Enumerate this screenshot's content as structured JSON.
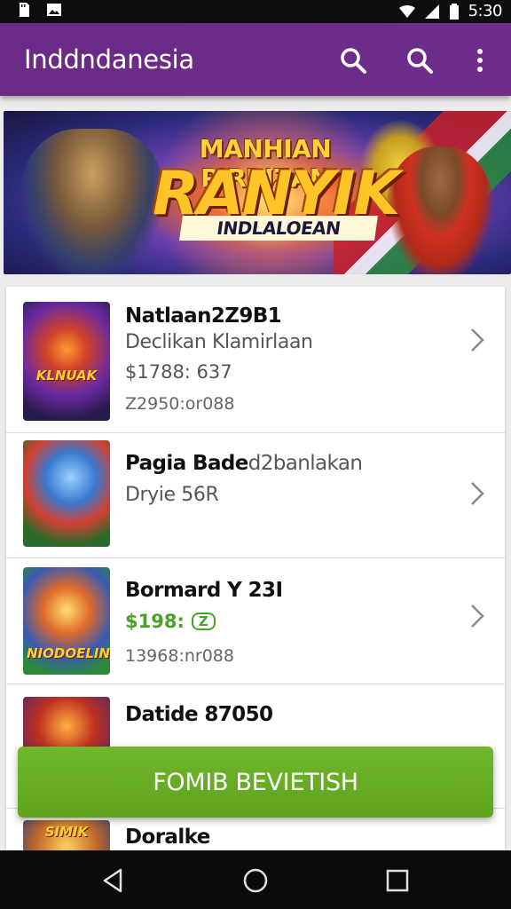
{
  "status_bar": {
    "time": "5:30",
    "icons": [
      "sd-card-icon",
      "image-icon",
      "wifi-icon",
      "signal-icon",
      "battery-icon"
    ]
  },
  "app_bar": {
    "title": "Inddndanesia",
    "actions": [
      "search-icon",
      "search-icon",
      "more-vert-icon"
    ],
    "color": "#6b2a86"
  },
  "banner": {
    "line1": "MANHIAN PIRBIZAN",
    "line2": "RANYIK",
    "line3": "INDLALOEAN"
  },
  "games": [
    {
      "title": "Natlaan2Z9B1",
      "subtitle": "Declikan Klamirlaan",
      "price": "$1788: 637",
      "meta": "Z2950:or088",
      "thumb_caption": "KLNUAK"
    },
    {
      "title": "Pagia Bade",
      "subtitle_extra": "d2banlakan",
      "subtitle": "Dryie 56R",
      "thumb_caption": ""
    },
    {
      "title": "Bormard Y 23I",
      "price": "$198:",
      "price_badge": "Z",
      "meta": "13968:nr088",
      "thumb_caption": "NIODOELIN"
    },
    {
      "title": "Datide 87050",
      "thumb_caption": ""
    },
    {
      "title": "Doralke",
      "thumb_caption": "SIMIK"
    }
  ],
  "cta": {
    "label": "FOMIB BEVIETISH",
    "color": "#66ad24"
  },
  "nav_bar": {
    "buttons": [
      "back-icon",
      "home-icon",
      "recents-icon"
    ]
  }
}
